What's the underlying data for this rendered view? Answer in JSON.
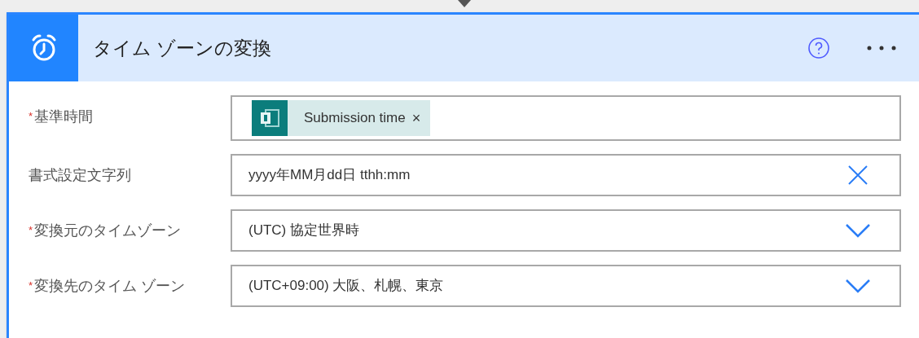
{
  "card": {
    "title": "タイム ゾーンの変換"
  },
  "required_mark": "*",
  "fields": [
    {
      "label": "基準時間",
      "required": true,
      "kind": "token",
      "value": "Submission time",
      "remove": "×"
    },
    {
      "label": "書式設定文字列",
      "required": false,
      "kind": "text",
      "value": "yyyy年MM月dd日 tthh:mm"
    },
    {
      "label": "変換元のタイムゾーン",
      "required": true,
      "kind": "dropdown",
      "value": "(UTC) 協定世界時"
    },
    {
      "label": "変換先のタイム ゾーン",
      "required": true,
      "kind": "dropdown",
      "value": "(UTC+09:00) 大阪、札幌、東京"
    }
  ]
}
